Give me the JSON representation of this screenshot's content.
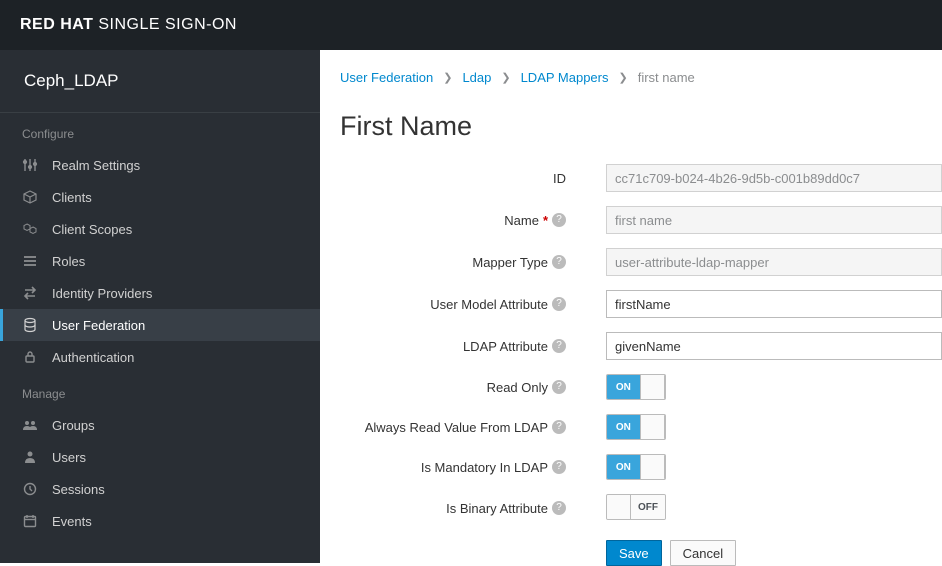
{
  "brand": {
    "bold": "RED HAT",
    "thin": "SINGLE SIGN-ON"
  },
  "realm": "Ceph_LDAP",
  "sections": {
    "configure": "Configure",
    "manage": "Manage"
  },
  "nav": {
    "configure": [
      {
        "label": "Realm Settings",
        "icon": "sliders"
      },
      {
        "label": "Clients",
        "icon": "cube"
      },
      {
        "label": "Client Scopes",
        "icon": "cubes"
      },
      {
        "label": "Roles",
        "icon": "list"
      },
      {
        "label": "Identity Providers",
        "icon": "exchange"
      },
      {
        "label": "User Federation",
        "icon": "database",
        "active": true
      },
      {
        "label": "Authentication",
        "icon": "lock"
      }
    ],
    "manage": [
      {
        "label": "Groups",
        "icon": "group"
      },
      {
        "label": "Users",
        "icon": "user"
      },
      {
        "label": "Sessions",
        "icon": "clock"
      },
      {
        "label": "Events",
        "icon": "calendar"
      }
    ]
  },
  "breadcrumbs": {
    "items": [
      {
        "label": "User Federation",
        "link": true
      },
      {
        "label": "Ldap",
        "link": true
      },
      {
        "label": "LDAP Mappers",
        "link": true
      },
      {
        "label": "first name",
        "link": false
      }
    ]
  },
  "page": {
    "title": "First Name"
  },
  "form": {
    "id_label": "ID",
    "id_value": "cc71c709-b024-4b26-9d5b-c001b89dd0c7",
    "name_label": "Name",
    "name_value": "first name",
    "mapper_type_label": "Mapper Type",
    "mapper_type_value": "user-attribute-ldap-mapper",
    "user_model_attr_label": "User Model Attribute",
    "user_model_attr_value": "firstName",
    "ldap_attr_label": "LDAP Attribute",
    "ldap_attr_value": "givenName",
    "read_only_label": "Read Only",
    "read_only_on": "ON",
    "always_read_label": "Always Read Value From LDAP",
    "always_read_on": "ON",
    "mandatory_label": "Is Mandatory In LDAP",
    "mandatory_on": "ON",
    "binary_label": "Is Binary Attribute",
    "binary_off": "OFF",
    "save": "Save",
    "cancel": "Cancel"
  }
}
